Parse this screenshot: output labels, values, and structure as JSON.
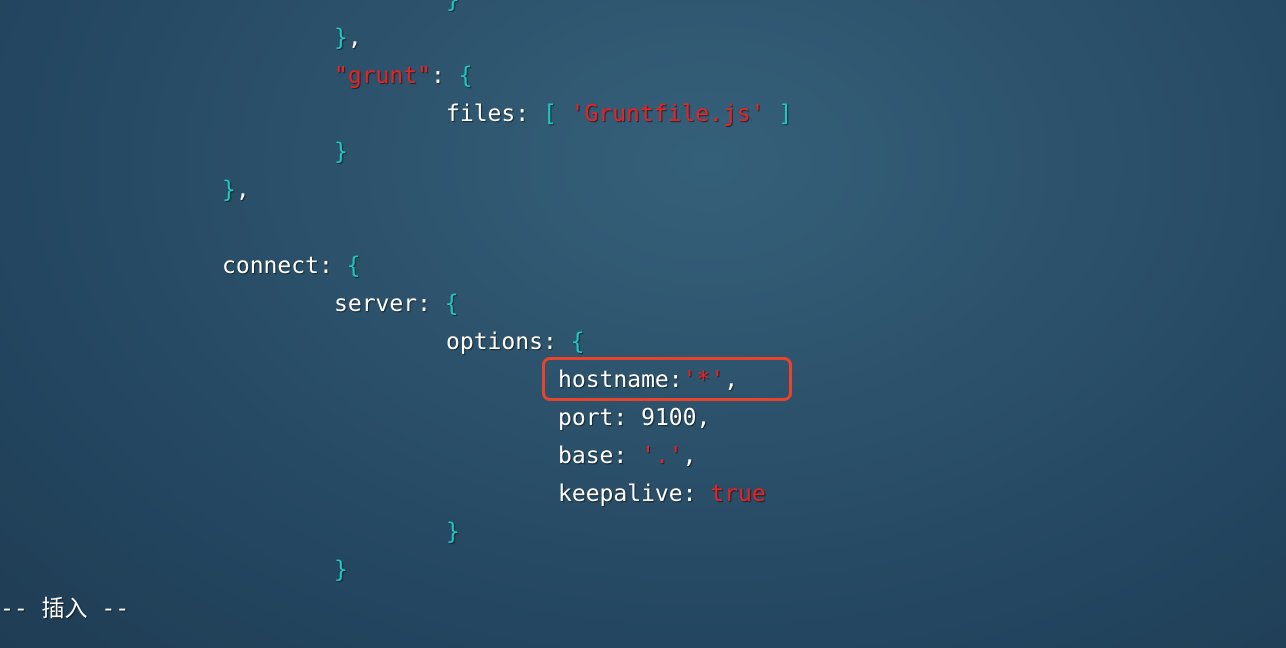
{
  "editor": {
    "lines": [
      {
        "indent": 4,
        "tokens": [
          {
            "t": "}",
            "c": "brace"
          }
        ]
      },
      {
        "indent": 3,
        "tokens": [
          {
            "t": "}",
            "c": "brace"
          },
          {
            "t": ",",
            "c": "punct"
          }
        ]
      },
      {
        "indent": 3,
        "tokens": [
          {
            "t": "\"",
            "c": "quote"
          },
          {
            "t": "grunt",
            "c": "str"
          },
          {
            "t": "\"",
            "c": "quote"
          },
          {
            "t": ": ",
            "c": "punct"
          },
          {
            "t": "{",
            "c": "brace"
          }
        ]
      },
      {
        "indent": 4,
        "tokens": [
          {
            "t": "files",
            "c": "key"
          },
          {
            "t": ": ",
            "c": "punct"
          },
          {
            "t": "[",
            "c": "brace"
          },
          {
            "t": " ",
            "c": "punct"
          },
          {
            "t": "'Gruntfile.js'",
            "c": "str"
          },
          {
            "t": " ",
            "c": "punct"
          },
          {
            "t": "]",
            "c": "brace"
          }
        ]
      },
      {
        "indent": 3,
        "tokens": [
          {
            "t": "}",
            "c": "brace"
          }
        ]
      },
      {
        "indent": 2,
        "tokens": [
          {
            "t": "}",
            "c": "brace"
          },
          {
            "t": ",",
            "c": "punct"
          }
        ]
      },
      {
        "indent": 0,
        "tokens": []
      },
      {
        "indent": 2,
        "tokens": [
          {
            "t": "connect",
            "c": "key"
          },
          {
            "t": ": ",
            "c": "punct"
          },
          {
            "t": "{",
            "c": "brace"
          }
        ]
      },
      {
        "indent": 3,
        "tokens": [
          {
            "t": "server",
            "c": "key"
          },
          {
            "t": ": ",
            "c": "punct"
          },
          {
            "t": "{",
            "c": "brace"
          }
        ]
      },
      {
        "indent": 4,
        "tokens": [
          {
            "t": "options",
            "c": "key"
          },
          {
            "t": ": ",
            "c": "punct"
          },
          {
            "t": "{",
            "c": "brace"
          }
        ]
      },
      {
        "indent": 5,
        "tokens": [
          {
            "t": "hostname",
            "c": "key"
          },
          {
            "t": ":",
            "c": "punct"
          },
          {
            "t": "'*'",
            "c": "str"
          },
          {
            "t": ",",
            "c": "punct"
          }
        ]
      },
      {
        "indent": 5,
        "tokens": [
          {
            "t": "port",
            "c": "key"
          },
          {
            "t": ": ",
            "c": "punct"
          },
          {
            "t": "9100",
            "c": "num"
          },
          {
            "t": ",",
            "c": "punct"
          }
        ]
      },
      {
        "indent": 5,
        "tokens": [
          {
            "t": "base",
            "c": "key"
          },
          {
            "t": ": ",
            "c": "punct"
          },
          {
            "t": "'.'",
            "c": "str"
          },
          {
            "t": ",",
            "c": "punct"
          }
        ]
      },
      {
        "indent": 5,
        "tokens": [
          {
            "t": "keepalive",
            "c": "key"
          },
          {
            "t": ": ",
            "c": "punct"
          },
          {
            "t": "true",
            "c": "bool"
          }
        ]
      },
      {
        "indent": 4,
        "tokens": [
          {
            "t": "}",
            "c": "brace"
          }
        ]
      },
      {
        "indent": 3,
        "tokens": [
          {
            "t": "}",
            "c": "brace"
          }
        ]
      }
    ]
  },
  "status_line": {
    "mode_text": "-- 插入 --"
  },
  "colors": {
    "background": "#2d536c",
    "brace": "#1ec8c0",
    "string": "#ee2020",
    "highlight_border": "#e8432c"
  }
}
